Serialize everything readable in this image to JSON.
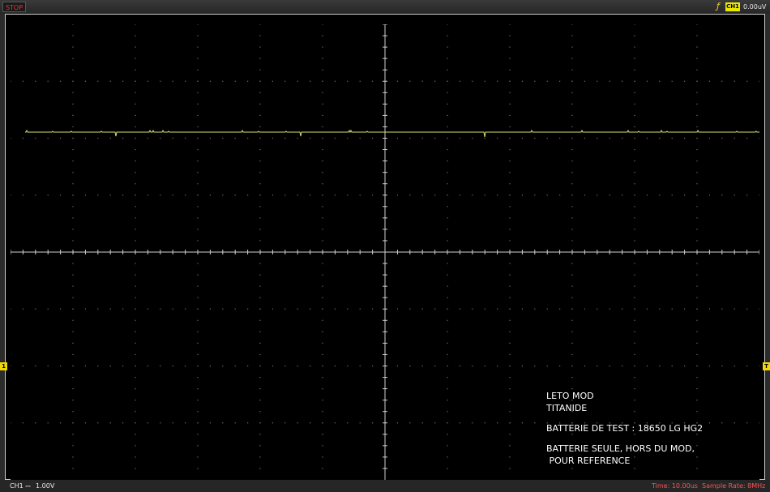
{
  "toolbar": {
    "run_state": "STOP",
    "trigger_slope_symbol": "ƒ",
    "trigger_channel": "CH1",
    "trigger_level": "0.00uV"
  },
  "status_bar": {
    "channel_label": "CH1 ⎓",
    "channel_scale": "1.00V",
    "time_base": "Time: 10.00us",
    "sample_rate": "Sample Rate: 8MHz"
  },
  "markers": {
    "channel_marker": "1",
    "trigger_marker": "T"
  },
  "annotation": {
    "line1": "LETO MOD",
    "line2": "TITANIDE",
    "line3": "BATTERIE DE TEST : 18650 LG HG2",
    "line4": "BATTERIE SEULE, HORS DU MOD,",
    "line5": " POUR REFERENCE"
  },
  "colors": {
    "trace": "#d8e070",
    "grid": "#707070",
    "axis": "#cfcfcf",
    "stop": "#ff2a2a",
    "marker": "#f0d800"
  }
}
